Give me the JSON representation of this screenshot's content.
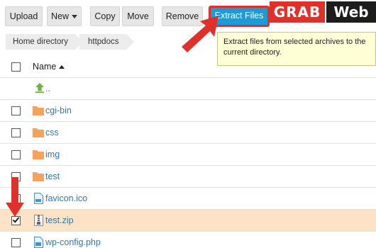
{
  "toolbar": {
    "upload_label": "Upload",
    "new_label": "New",
    "copy_label": "Copy",
    "move_label": "Move",
    "remove_label": "Remove",
    "extract_label": "Extract Files"
  },
  "logo": {
    "part1": "GRAB",
    "part2": "Web"
  },
  "breadcrumb": [
    "Home directory",
    "httpdocs"
  ],
  "tooltip": "Extract files from selected archives to the current directory.",
  "table": {
    "name_header": "Name",
    "parent_label": "..",
    "rows": [
      {
        "name": "cgi-bin",
        "type": "folder",
        "checked": false
      },
      {
        "name": "css",
        "type": "folder",
        "checked": false
      },
      {
        "name": "img",
        "type": "folder",
        "checked": false
      },
      {
        "name": "test",
        "type": "folder",
        "checked": false
      },
      {
        "name": "favicon.ico",
        "type": "file",
        "checked": false
      },
      {
        "name": "test.zip",
        "type": "archive",
        "checked": true
      },
      {
        "name": "wp-config.php",
        "type": "php",
        "checked": false
      }
    ]
  },
  "colors": {
    "accent": "#1e9ad6",
    "highlight": "#e0302a",
    "selected_row": "#fde3c6",
    "folder": "#f5a25d",
    "link": "#2a7ab0"
  },
  "icons": {
    "up": "arrow-up-icon",
    "folder": "folder-icon",
    "file": "file-icon",
    "archive": "archive-icon"
  }
}
